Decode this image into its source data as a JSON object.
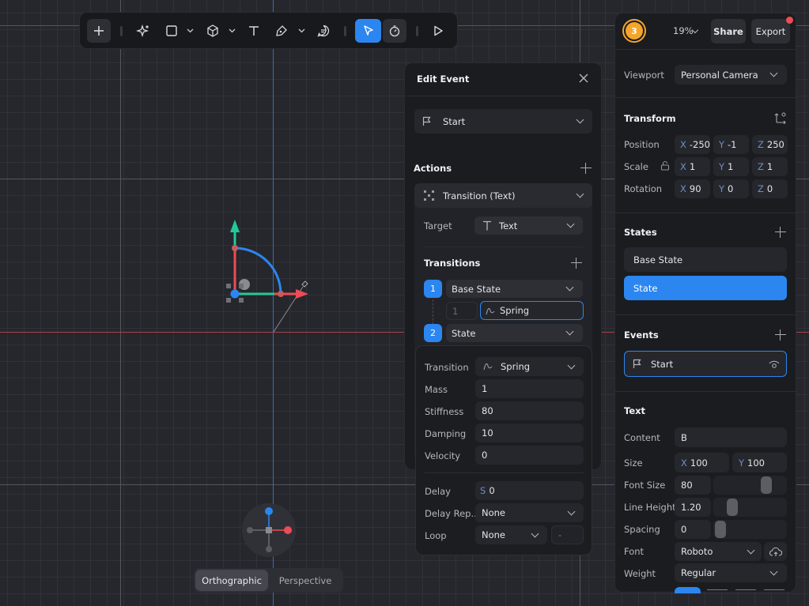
{
  "toolbar": {
    "tools": [
      "add",
      "ai-sparkle",
      "rectangle",
      "cube",
      "text",
      "pen",
      "comment",
      "select",
      "hand",
      "play"
    ]
  },
  "right_panel": {
    "avatar_count": "3",
    "zoom": "19%",
    "share_label": "Share",
    "export_label": "Export",
    "viewport_label": "Viewport",
    "viewport_value": "Personal Camera",
    "transform_title": "Transform",
    "position_label": "Position",
    "position": {
      "x": "-250",
      "y": "-1",
      "z": "250"
    },
    "scale_label": "Scale",
    "scale": {
      "x": "1",
      "y": "1",
      "z": "1"
    },
    "rotation_label": "Rotation",
    "rotation": {
      "x": "90",
      "y": "0",
      "z": "0"
    },
    "states_title": "States",
    "states": [
      "Base State",
      "State"
    ],
    "events_title": "Events",
    "event_item": "Start",
    "text_title": "Text",
    "content_label": "Content",
    "content_value": "B",
    "size_label": "Size",
    "size": {
      "x": "100",
      "y": "100"
    },
    "font_size_label": "Font Size",
    "font_size": "80",
    "font_size_slider": 0.8,
    "line_height_label": "Line Height",
    "line_height": "1.20",
    "line_height_slider": 0.25,
    "spacing_label": "Spacing",
    "spacing": "0",
    "spacing_slider": 0.0,
    "font_label": "Font",
    "font_value": "Roboto",
    "weight_label": "Weight",
    "weight_value": "Regular",
    "axis_letters": {
      "x": "X",
      "y": "Y",
      "z": "Z"
    }
  },
  "edit_event": {
    "title": "Edit Event",
    "trigger": "Start",
    "actions_title": "Actions",
    "action_item": "Transition (Text)",
    "target_label": "Target",
    "target_value": "Text",
    "transitions_title": "Transitions",
    "step1_num": "1",
    "step1_state": "Base State",
    "step_duration_placeholder": "1",
    "step_transition": "Spring",
    "step2_num": "2",
    "step2_state": "State"
  },
  "spring_panel": {
    "transition_label": "Transition",
    "transition_value": "Spring",
    "mass_label": "Mass",
    "mass": "1",
    "stiffness_label": "Stiffness",
    "stiffness": "80",
    "damping_label": "Damping",
    "damping": "10",
    "velocity_label": "Velocity",
    "velocity": "0",
    "delay_label": "Delay",
    "delay_prefix": "S",
    "delay": "0",
    "delay_repeat_label": "Delay Rep...",
    "delay_repeat": "None",
    "loop_label": "Loop",
    "loop": "None",
    "loop_count": "-"
  },
  "view_toggle": {
    "orthographic": "Orthographic",
    "perspective": "Perspective"
  },
  "colors": {
    "accent": "#2b86f0",
    "x_axis": "#ef4b55",
    "y_axis": "#22c99a",
    "avatar": "#f4a52b"
  }
}
